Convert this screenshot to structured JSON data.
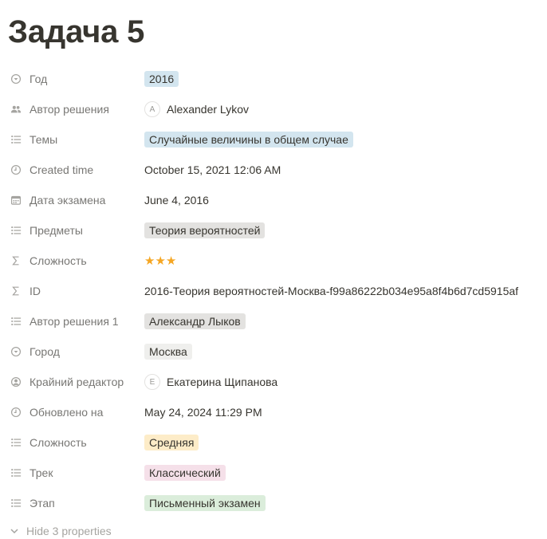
{
  "title": "Задача 5",
  "colors": {
    "blue_tag": "#d3e5ef",
    "gray_tag": "#e3e2e0",
    "yellow_tag": "#fdecc8",
    "pink_tag": "#f5e0e9",
    "green_tag": "#dbeddb",
    "star": "#f5a623"
  },
  "properties": [
    {
      "label": "Год",
      "icon": "select-icon",
      "value": "2016",
      "kind": "tag",
      "color": "#d3e5ef"
    },
    {
      "label": "Автор решения",
      "icon": "people-icon",
      "value": "Alexander Lykov",
      "avatar": "A",
      "kind": "person"
    },
    {
      "label": "Темы",
      "icon": "list-icon",
      "value": "Случайные величины в общем случае",
      "kind": "tag",
      "color": "#d3e5ef"
    },
    {
      "label": "Created time",
      "icon": "clock-icon",
      "value": "October 15, 2021 12:06 AM",
      "kind": "text"
    },
    {
      "label": "Дата экзамена",
      "icon": "calendar-icon",
      "value": "June 4, 2016",
      "kind": "text"
    },
    {
      "label": "Предметы",
      "icon": "list-icon",
      "value": "Теория вероятностей",
      "kind": "tag",
      "color": "#e3e2e0"
    },
    {
      "label": "Сложность",
      "icon": "sigma-icon",
      "value": "★★★",
      "kind": "stars"
    },
    {
      "label": "ID",
      "icon": "sigma-icon",
      "value": "2016-Теория вероятностей-Москва-f99a86222b034e95a8f4b6d7cd5915af",
      "kind": "text"
    },
    {
      "label": "Автор решения 1",
      "icon": "list-icon",
      "value": "Александр Лыков",
      "kind": "tag",
      "color": "#e3e2e0"
    },
    {
      "label": "Город",
      "icon": "select-icon",
      "value": "Москва",
      "kind": "tag",
      "color": "#efefed"
    },
    {
      "label": "Крайний редактор",
      "icon": "person-circle-icon",
      "value": "Екатерина Щипанова",
      "avatar": "E",
      "kind": "person"
    },
    {
      "label": "Обновлено на",
      "icon": "clock-icon",
      "value": "May 24, 2024 11:29 PM",
      "kind": "text"
    },
    {
      "label": "Сложность",
      "icon": "list-icon",
      "value": "Средняя",
      "kind": "tag",
      "color": "#fdecc8"
    },
    {
      "label": "Трек",
      "icon": "list-icon",
      "value": "Классический",
      "kind": "tag",
      "color": "#f5e0e9"
    },
    {
      "label": "Этап",
      "icon": "list-icon",
      "value": "Письменный экзамен",
      "kind": "tag",
      "color": "#dbeddb"
    }
  ],
  "hide_properties_label": "Hide 3 properties"
}
